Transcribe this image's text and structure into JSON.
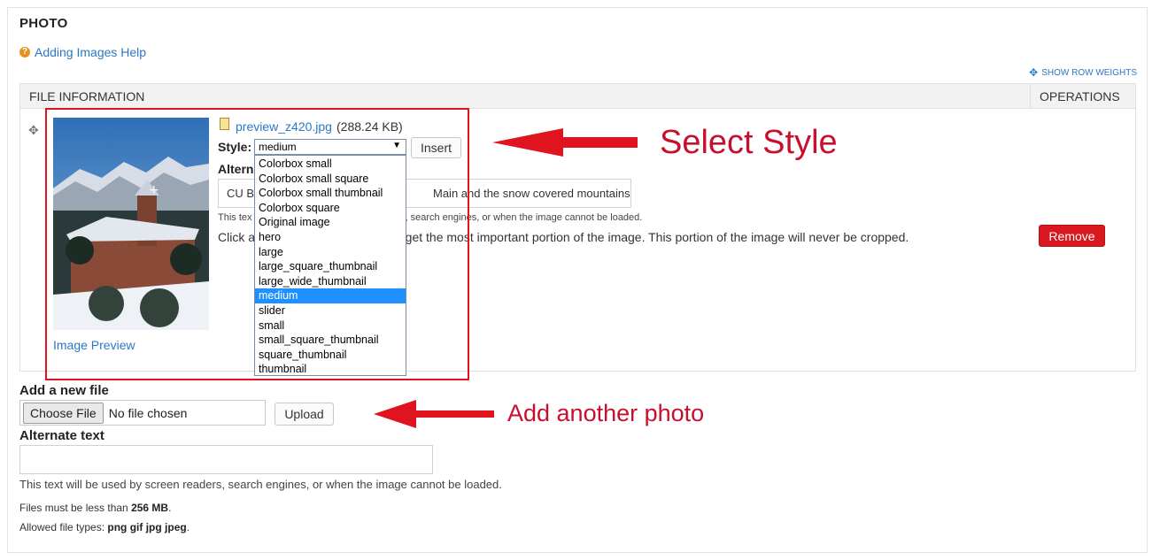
{
  "section": {
    "title": "PHOTO",
    "help_link": "Adding Images Help",
    "row_weights_link": "SHOW ROW WEIGHTS"
  },
  "table": {
    "headers": [
      "FILE INFORMATION",
      "OPERATIONS"
    ],
    "row": {
      "file_name": "preview_z420.jpg",
      "file_size": "(288.24 KB)",
      "style_label": "Style:",
      "style_selected": "medium",
      "style_options": [
        "Colorbox small",
        "Colorbox small square",
        "Colorbox small thumbnail",
        "Colorbox square",
        "Original image",
        "hero",
        "large",
        "large_square_thumbnail",
        "large_wide_thumbnail",
        "medium",
        "slider",
        "small",
        "small_square_thumbnail",
        "square_thumbnail",
        "thumbnail"
      ],
      "insert_label": "Insert",
      "alt_label_visible": "Altern",
      "alt_value_left": "CU B",
      "alt_value_right": "Main and the snow covered mountains",
      "alt_hint_left": "This tex",
      "alt_hint_right": "s, search engines, or when the image cannot be loaded.",
      "focus_hint_left": "Click a",
      "focus_hint_right": "rget the most important portion of the image. This portion of the image will never be cropped.",
      "image_preview_link": "Image Preview",
      "remove_label": "Remove"
    }
  },
  "annotations": {
    "select_style": "Select Style",
    "add_another": "Add another photo",
    "color": "#c8102e"
  },
  "new_file": {
    "label": "Add a new file",
    "choose_label": "Choose File",
    "no_file": "No file chosen",
    "upload_label": "Upload",
    "alt_label": "Alternate text",
    "alt_value": "",
    "alt_hint": "This text will be used by screen readers, search engines, or when the image cannot be loaded.",
    "size_prefix": "Files must be less than",
    "size_value": "256 MB",
    "size_suffix": ".",
    "types_prefix": "Allowed file types:",
    "types_value": "png gif jpg jpeg",
    "types_suffix": "."
  }
}
